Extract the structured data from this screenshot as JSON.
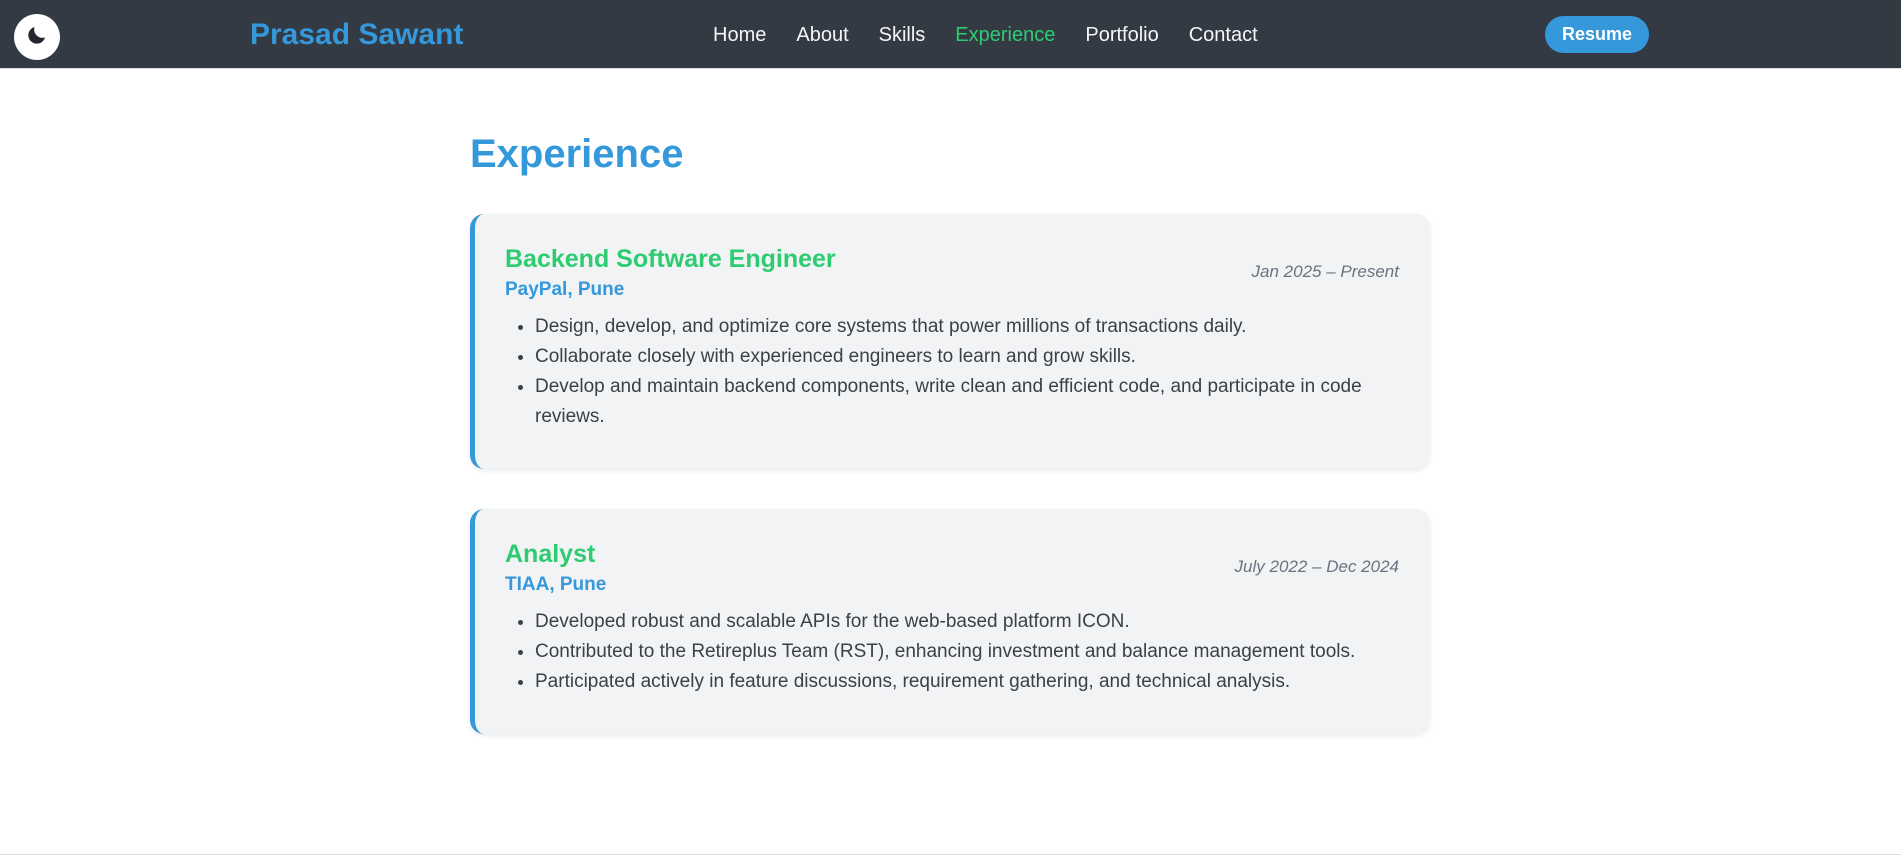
{
  "header": {
    "brand": "Prasad Sawant",
    "theme_toggle_icon": "moon-icon",
    "nav": [
      {
        "label": "Home",
        "active": false
      },
      {
        "label": "About",
        "active": false
      },
      {
        "label": "Skills",
        "active": false
      },
      {
        "label": "Experience",
        "active": true
      },
      {
        "label": "Portfolio",
        "active": false
      },
      {
        "label": "Contact",
        "active": false
      }
    ],
    "resume_label": "Resume"
  },
  "main": {
    "title": "Experience",
    "jobs": [
      {
        "role": "Backend Software Engineer",
        "company": "PayPal, Pune",
        "dates": "Jan 2025 – Present",
        "duties": [
          "Design, develop, and optimize core systems that power millions of transactions daily.",
          "Collaborate closely with experienced engineers to learn and grow skills.",
          "Develop and maintain backend components, write clean and efficient code, and participate in code reviews."
        ]
      },
      {
        "role": "Analyst",
        "company": "TIAA, Pune",
        "dates": "July 2022 – Dec 2024",
        "duties": [
          "Developed robust and scalable APIs for the web-based platform ICON.",
          "Contributed to the Retireplus Team (RST), enhancing investment and balance management tools.",
          "Participated actively in feature discussions, requirement gathering, and technical analysis."
        ]
      }
    ]
  },
  "colors": {
    "navbar_bg": "#343a44",
    "accent_blue": "#3498db",
    "accent_green": "#2ecc71",
    "card_bg": "#f2f3f5"
  }
}
